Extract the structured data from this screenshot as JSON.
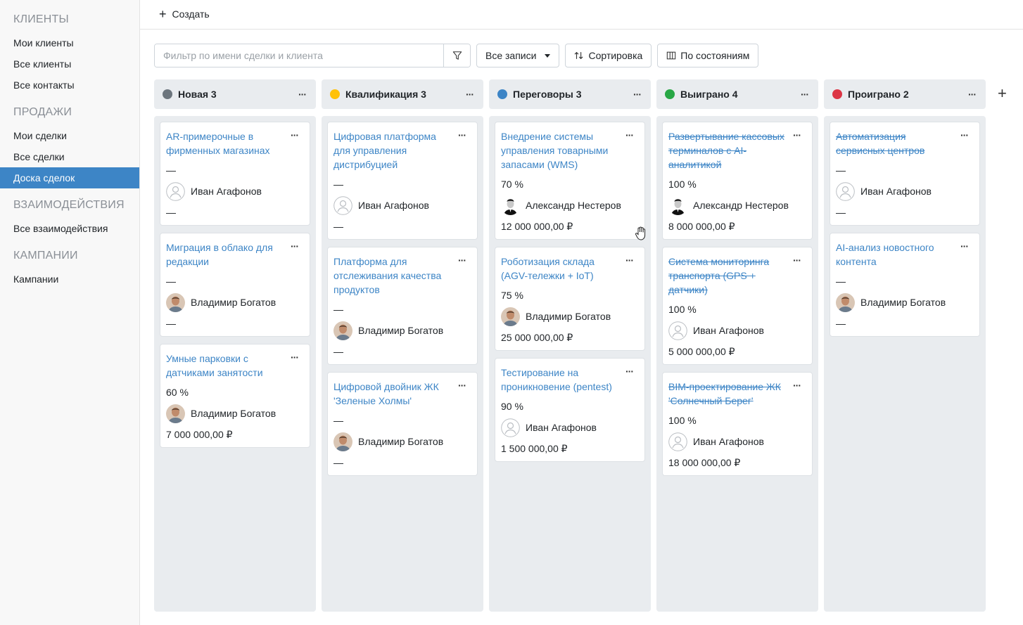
{
  "sidebar": {
    "sections": [
      {
        "title": "КЛИЕНТЫ",
        "items": [
          "Мои клиенты",
          "Все клиенты",
          "Все контакты"
        ]
      },
      {
        "title": "ПРОДАЖИ",
        "items": [
          "Мои сделки",
          "Все сделки",
          "Доска сделок"
        ]
      },
      {
        "title": "ВЗАИМОДЕЙСТВИЯ",
        "items": [
          "Все взаимодействия"
        ]
      },
      {
        "title": "КАМПАНИИ",
        "items": [
          "Кампании"
        ]
      }
    ],
    "active_item": "Доска сделок"
  },
  "topbar": {
    "create_label": "Создать"
  },
  "toolbar": {
    "filter_placeholder": "Фильтр по имени сделки и клиента",
    "records_label": "Все записи",
    "sort_label": "Сортировка",
    "by_state_label": "По состояниям"
  },
  "columns": [
    {
      "title": "Новая 3",
      "color": "#6c757d",
      "cards": [
        {
          "title": "AR-примерочные в фирменных магазинах",
          "prob": "—",
          "owner": "Иван Агафонов",
          "avatar": "empty",
          "amount": "—",
          "lost": false
        },
        {
          "title": "Миграция в облако для редакции",
          "prob": "—",
          "owner": "Владимир Богатов",
          "avatar": "photo",
          "amount": "—",
          "lost": false
        },
        {
          "title": "Умные парковки с датчиками занятости",
          "prob": "60 %",
          "owner": "Владимир Богатов",
          "avatar": "photo",
          "amount": "7 000 000,00 ₽",
          "lost": false
        }
      ]
    },
    {
      "title": "Квалификация 3",
      "color": "#ffc107",
      "cards": [
        {
          "title": "Цифровая платформа для управления дистрибуцией",
          "prob": "—",
          "owner": "Иван Агафонов",
          "avatar": "empty",
          "amount": "—",
          "lost": false
        },
        {
          "title": "Платформа для отслеживания качества продуктов",
          "prob": "—",
          "owner": "Владимир Богатов",
          "avatar": "photo",
          "amount": "—",
          "lost": false
        },
        {
          "title": "Цифровой двойник ЖК 'Зеленые Холмы'",
          "prob": "—",
          "owner": "Владимир Богатов",
          "avatar": "photo",
          "amount": "—",
          "lost": false
        }
      ]
    },
    {
      "title": "Переговоры 3",
      "color": "#3d85c6",
      "cards": [
        {
          "title": "Внедрение системы управления товарными запасами (WMS)",
          "prob": "70 %",
          "owner": "Александр Нестеров",
          "avatar": "photo2",
          "amount": "12 000 000,00 ₽",
          "lost": false
        },
        {
          "title": "Роботизация склада (AGV-тележки + IoT)",
          "prob": "75 %",
          "owner": "Владимир Богатов",
          "avatar": "photo",
          "amount": "25 000 000,00 ₽",
          "lost": false
        },
        {
          "title": "Тестирование на проникновение (pentest)",
          "prob": "90 %",
          "owner": "Иван Агафонов",
          "avatar": "empty",
          "amount": "1 500 000,00 ₽",
          "lost": false
        }
      ]
    },
    {
      "title": "Выиграно 4",
      "color": "#28a745",
      "cards": [
        {
          "title": "Развертывание кассовых терминалов с AI-аналитикой",
          "prob": "100 %",
          "owner": "Александр Нестеров",
          "avatar": "photo2",
          "amount": "8 000 000,00 ₽",
          "lost": true
        },
        {
          "title": "Система мониторинга транспорта (GPS + датчики)",
          "prob": "100 %",
          "owner": "Иван Агафонов",
          "avatar": "empty",
          "amount": "5 000 000,00 ₽",
          "lost": true
        },
        {
          "title": "BIM-проектирование ЖК 'Солнечный Берег'",
          "prob": "100 %",
          "owner": "Иван Агафонов",
          "avatar": "empty",
          "amount": "18 000 000,00 ₽",
          "lost": true
        }
      ]
    },
    {
      "title": "Проиграно 2",
      "color": "#dc3545",
      "cards": [
        {
          "title": "Автоматизация сервисных центров",
          "prob": "—",
          "owner": "Иван Агафонов",
          "avatar": "empty",
          "amount": "—",
          "lost": true
        },
        {
          "title": "AI-анализ новостного контента",
          "prob": "—",
          "owner": "Владимир Богатов",
          "avatar": "photo",
          "amount": "—",
          "lost": false
        }
      ]
    }
  ]
}
